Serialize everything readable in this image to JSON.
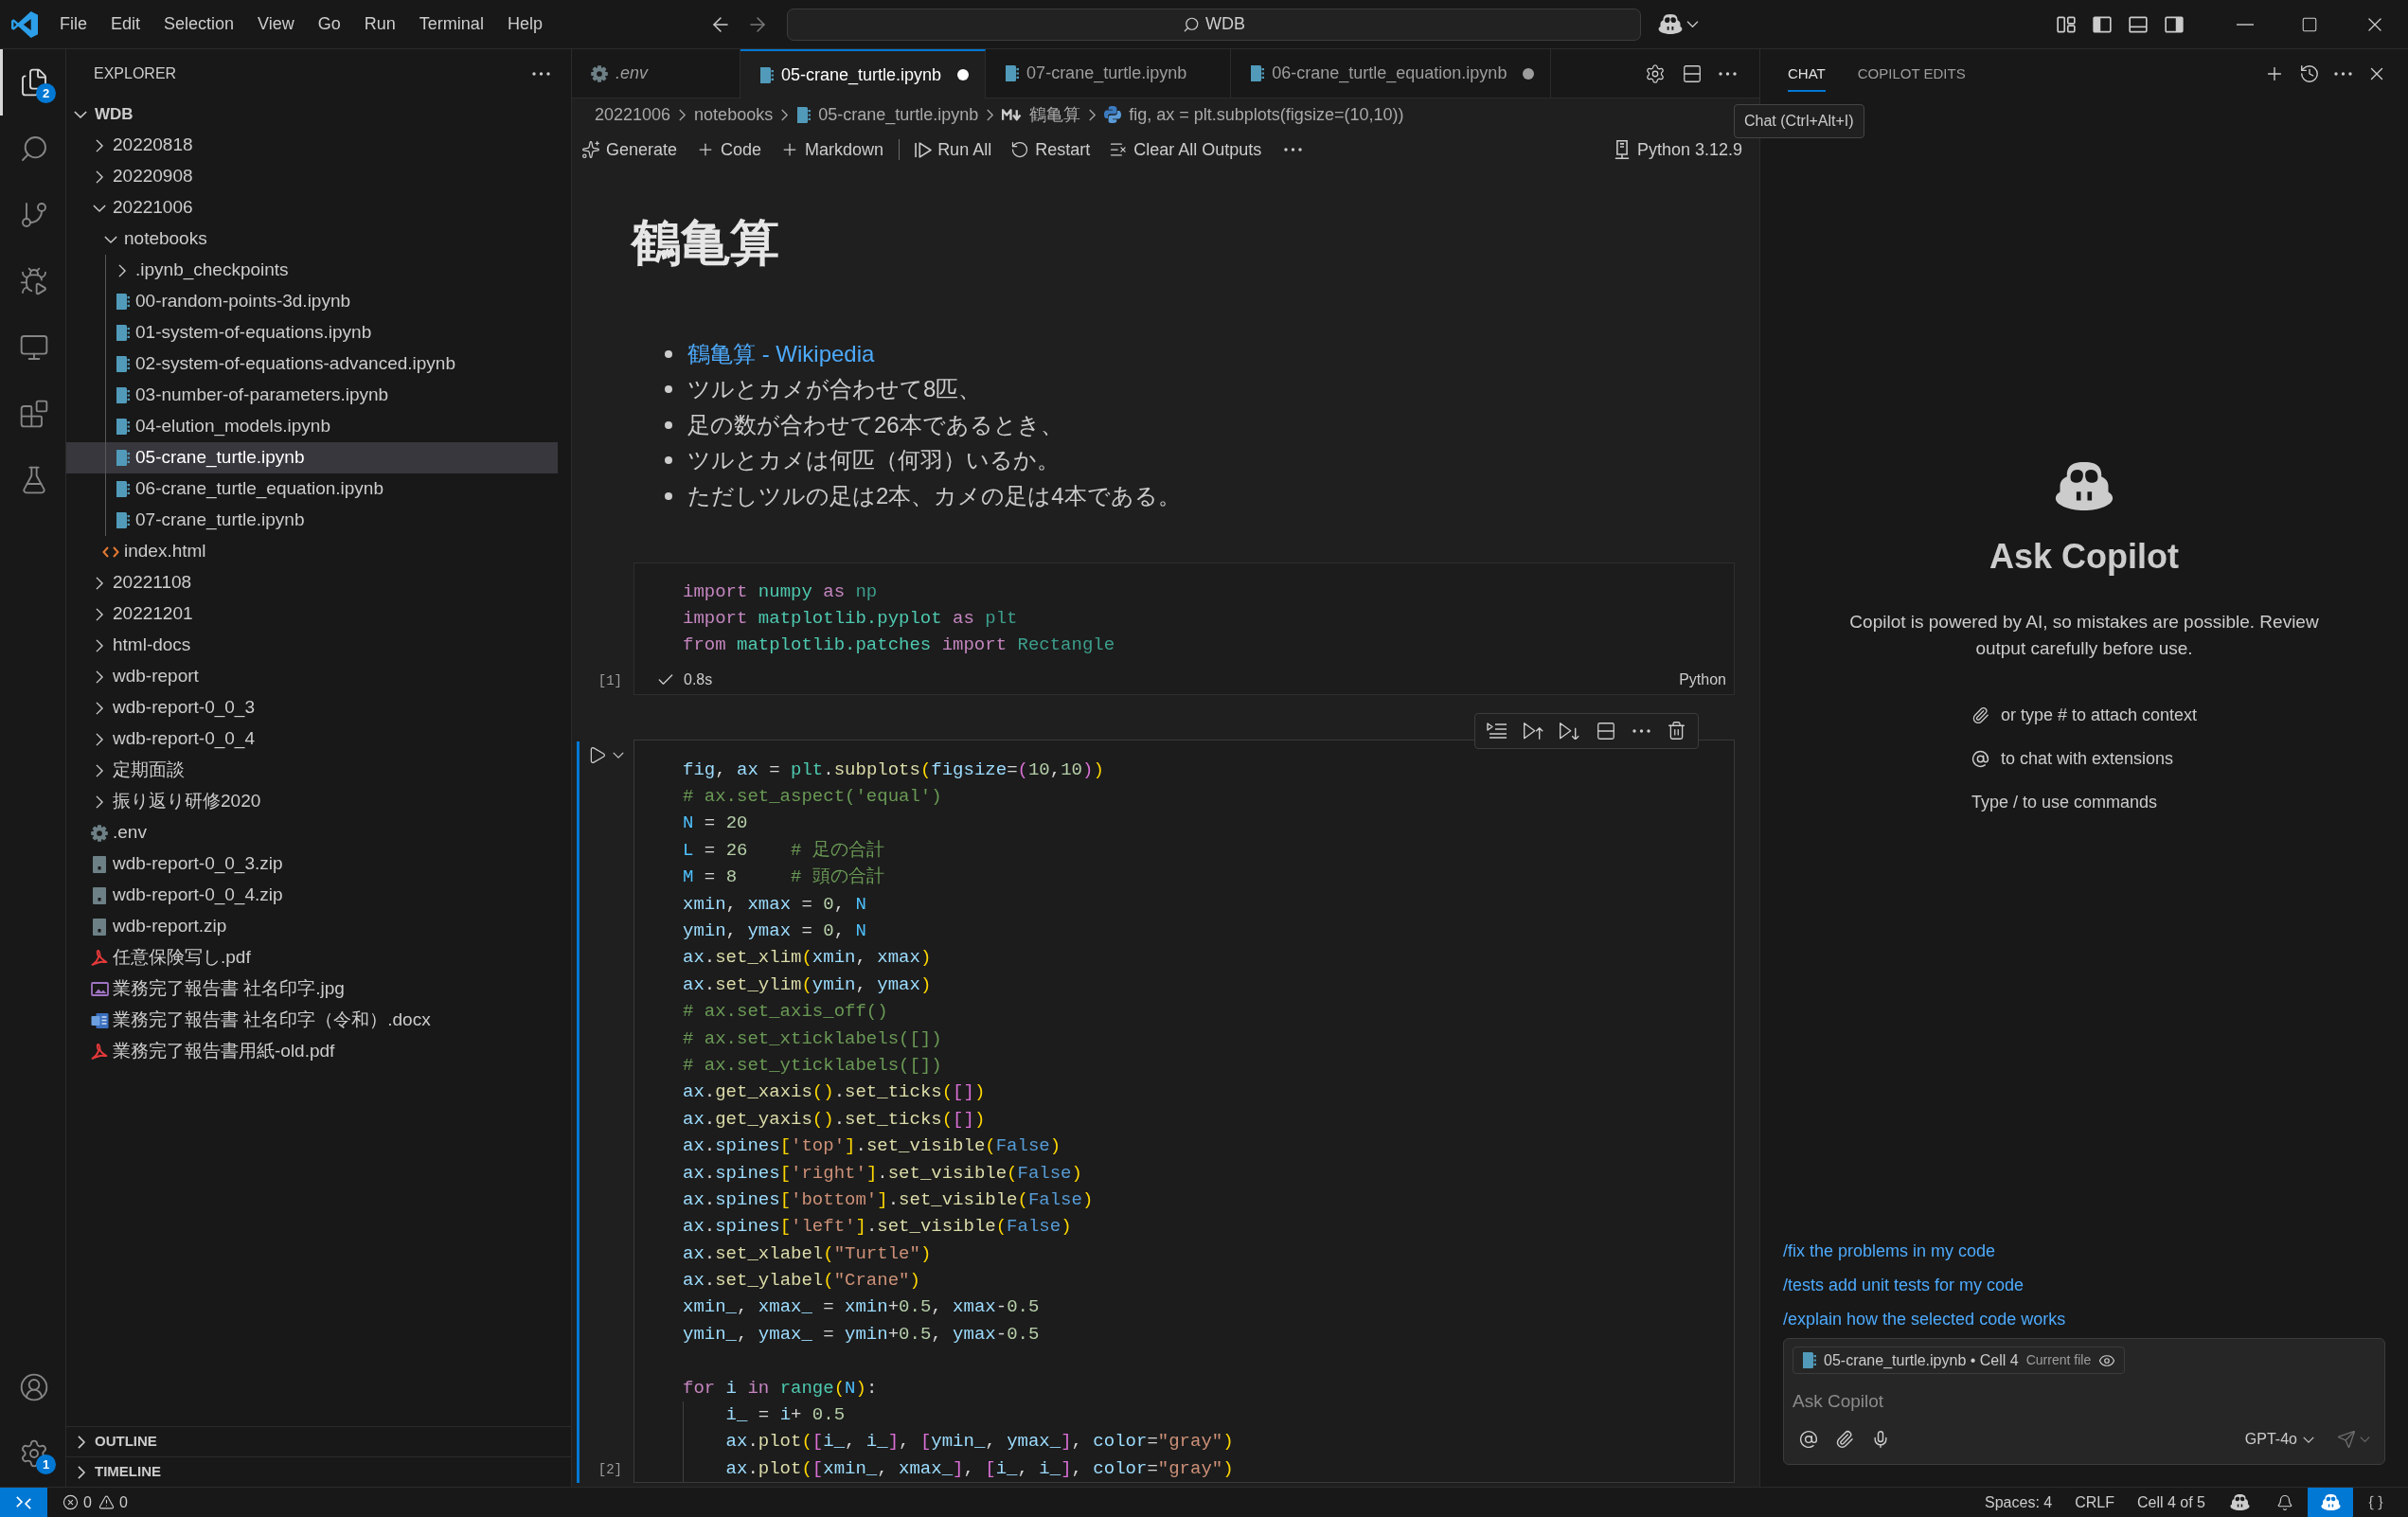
{
  "title_bar": {
    "menu": [
      "File",
      "Edit",
      "Selection",
      "View",
      "Go",
      "Run",
      "Terminal",
      "Help"
    ],
    "command_center": "WDB",
    "layout_toggles": [
      {
        "kind": "customize"
      },
      {
        "kind": "primary_sidebar",
        "on": true
      },
      {
        "kind": "panel",
        "on": false
      },
      {
        "kind": "secondary_sidebar",
        "on": true
      }
    ]
  },
  "activity_bar": {
    "items": [
      {
        "kind": "explorer",
        "selected": true,
        "badge": "2"
      },
      {
        "kind": "search",
        "selected": false
      },
      {
        "kind": "source_control",
        "selected": false
      },
      {
        "kind": "run_debug",
        "selected": false
      },
      {
        "kind": "remote",
        "selected": false
      },
      {
        "kind": "extensions",
        "selected": false
      },
      {
        "kind": "testing",
        "selected": false
      }
    ],
    "bottom": [
      {
        "kind": "account"
      },
      {
        "kind": "manage",
        "badge": "1"
      }
    ]
  },
  "sidebar": {
    "title": "EXPLORER",
    "root": {
      "label": "WDB",
      "expanded": true,
      "selected": false,
      "children": [
        {
          "kind": "folder",
          "label": "20220818",
          "expanded": false,
          "selected": false
        },
        {
          "kind": "folder",
          "label": "20220908",
          "expanded": false,
          "selected": false
        },
        {
          "kind": "folder",
          "label": "20221006",
          "expanded": true,
          "selected": false,
          "children": [
            {
              "kind": "folder",
              "label": "notebooks",
              "expanded": true,
              "selected": false,
              "children": [
                {
                  "kind": "folder",
                  "label": ".ipynb_checkpoints",
                  "expanded": false,
                  "selected": false
                },
                {
                  "kind": "notebook",
                  "label": "00-random-points-3d.ipynb",
                  "selected": false
                },
                {
                  "kind": "notebook",
                  "label": "01-system-of-equations.ipynb",
                  "selected": false
                },
                {
                  "kind": "notebook",
                  "label": "02-system-of-equations-advanced.ipynb",
                  "selected": false
                },
                {
                  "kind": "notebook",
                  "label": "03-number-of-parameters.ipynb",
                  "selected": false
                },
                {
                  "kind": "notebook",
                  "label": "04-elution_models.ipynb",
                  "selected": false
                },
                {
                  "kind": "notebook",
                  "label": "05-crane_turtle.ipynb",
                  "selected": true
                },
                {
                  "kind": "notebook",
                  "label": "06-crane_turtle_equation.ipynb",
                  "selected": false
                },
                {
                  "kind": "notebook",
                  "label": "07-crane_turtle.ipynb",
                  "selected": false
                }
              ]
            },
            {
              "kind": "html",
              "label": "index.html",
              "selected": false
            }
          ]
        },
        {
          "kind": "folder",
          "label": "20221108",
          "expanded": false,
          "selected": false
        },
        {
          "kind": "folder",
          "label": "20221201",
          "expanded": false,
          "selected": false
        },
        {
          "kind": "folder",
          "label": "html-docs",
          "expanded": false,
          "selected": false
        },
        {
          "kind": "folder",
          "label": "wdb-report",
          "expanded": false,
          "selected": false
        },
        {
          "kind": "folder",
          "label": "wdb-report-0_0_3",
          "expanded": false,
          "selected": false
        },
        {
          "kind": "folder",
          "label": "wdb-report-0_0_4",
          "expanded": false,
          "selected": false
        },
        {
          "kind": "folder",
          "label": "定期面談",
          "expanded": false,
          "selected": false
        },
        {
          "kind": "folder",
          "label": "振り返り研修2020",
          "expanded": false,
          "selected": false
        },
        {
          "kind": "env",
          "label": ".env",
          "selected": false
        },
        {
          "kind": "zip",
          "label": "wdb-report-0_0_3.zip",
          "selected": false
        },
        {
          "kind": "zip",
          "label": "wdb-report-0_0_4.zip",
          "selected": false
        },
        {
          "kind": "zip",
          "label": "wdb-report.zip",
          "selected": false
        },
        {
          "kind": "pdf",
          "label": "任意保険写し.pdf",
          "selected": false
        },
        {
          "kind": "image",
          "label": "業務完了報告書 社名印字.jpg",
          "selected": false
        },
        {
          "kind": "word",
          "label": "業務完了報告書 社名印字（令和）.docx",
          "selected": false
        },
        {
          "kind": "pdf",
          "label": "業務完了報告書用紙-old.pdf",
          "selected": false
        }
      ]
    },
    "sections": [
      {
        "label": "OUTLINE",
        "expanded": false
      },
      {
        "label": "TIMELINE",
        "expanded": false
      }
    ]
  },
  "editor": {
    "tabs": [
      {
        "kind": "env",
        "label": ".env",
        "selected": false,
        "modified": false,
        "preview": true
      },
      {
        "kind": "notebook",
        "label": "05-crane_turtle.ipynb",
        "selected": true,
        "modified": true,
        "preview": false
      },
      {
        "kind": "notebook",
        "label": "07-crane_turtle.ipynb",
        "selected": false,
        "modified": false,
        "preview": false
      },
      {
        "kind": "notebook",
        "label": "06-crane_turtle_equation.ipynb",
        "selected": false,
        "modified": true,
        "preview": false
      }
    ],
    "breadcrumbs": [
      {
        "kind": "folder",
        "label": "20221006"
      },
      {
        "kind": "folder",
        "label": "notebooks"
      },
      {
        "kind": "notebook",
        "label": "05-crane_turtle.ipynb"
      },
      {
        "kind": "markdown",
        "label": "鶴亀算"
      },
      {
        "kind": "python",
        "label": "fig, ax = plt.subplots(figsize=(10,10))"
      }
    ],
    "toolbar": {
      "insert_actions": [
        {
          "kind": "generate",
          "label": "Generate"
        },
        {
          "kind": "add",
          "label": "Code"
        },
        {
          "kind": "add",
          "label": "Markdown"
        }
      ],
      "run_actions": [
        {
          "kind": "run_all",
          "label": "Run All"
        },
        {
          "kind": "restart",
          "label": "Restart"
        },
        {
          "kind": "clear",
          "label": "Clear All Outputs"
        }
      ],
      "kernel": "Python 3.12.9"
    },
    "cells": [
      {
        "kind": "markdown",
        "heading": "鶴亀算",
        "bullets": [
          {
            "text": "鶴亀算 - Wikipedia",
            "link": true
          },
          {
            "text": "ツルとカメが合わせて8匹、",
            "link": false
          },
          {
            "text": "足の数が合わせて26本であるとき、",
            "link": false
          },
          {
            "text": "ツルとカメは何匹（何羽）いるか。",
            "link": false
          },
          {
            "text": "ただしツルの足は2本、カメの足は4本である。",
            "link": false
          }
        ]
      },
      {
        "kind": "code",
        "selected": false,
        "execution_count": "[1]",
        "run": {
          "succeeded": true,
          "duration": "0.8s"
        },
        "language": "Python",
        "blocks": [
          [
            {
              "tokens": [
                {
                  "kind": "keyword",
                  "text": "import"
                },
                {
                  "kind": "module",
                  "text": " numpy"
                },
                {
                  "kind": "keyword",
                  "text": " as"
                },
                {
                  "kind": "alias",
                  "text": " np"
                }
              ]
            },
            {
              "tokens": [
                {
                  "kind": "keyword",
                  "text": "import"
                },
                {
                  "kind": "module",
                  "text": " matplotlib.pyplot"
                },
                {
                  "kind": "keyword",
                  "text": " as"
                },
                {
                  "kind": "alias",
                  "text": " plt"
                }
              ]
            },
            {
              "tokens": [
                {
                  "kind": "keyword",
                  "text": "from"
                },
                {
                  "kind": "module",
                  "text": " matplotlib.patches"
                },
                {
                  "kind": "keyword",
                  "text": " import"
                },
                {
                  "kind": "alias",
                  "text": " Rectangle"
                }
              ]
            }
          ]
        ]
      },
      {
        "kind": "code",
        "selected": true,
        "execution_count": "[2]",
        "blocks": [
          [
            {
              "tokens": [
                {
                  "kind": "variable",
                  "text": "fig"
                },
                {
                  "kind": "plain",
                  "text": ", "
                },
                {
                  "kind": "variable",
                  "text": "ax"
                },
                {
                  "kind": "plain",
                  "text": " = "
                },
                {
                  "kind": "module",
                  "text": "plt"
                },
                {
                  "kind": "plain",
                  "text": "."
                },
                {
                  "kind": "function",
                  "text": "subplots"
                },
                {
                  "kind": "outer_bracket",
                  "text": "("
                },
                {
                  "kind": "variable",
                  "text": "figsize"
                },
                {
                  "kind": "plain",
                  "text": "="
                },
                {
                  "kind": "inner_bracket",
                  "text": "("
                },
                {
                  "kind": "number",
                  "text": "10"
                },
                {
                  "kind": "plain",
                  "text": ","
                },
                {
                  "kind": "number",
                  "text": "10"
                },
                {
                  "kind": "inner_bracket",
                  "text": ")"
                },
                {
                  "kind": "outer_bracket",
                  "text": ")"
                }
              ]
            },
            {
              "tokens": [
                {
                  "kind": "comment",
                  "text": "# ax.set_aspect('equal')"
                }
              ]
            },
            {
              "tokens": [
                {
                  "kind": "constant",
                  "text": "N"
                },
                {
                  "kind": "plain",
                  "text": " = "
                },
                {
                  "kind": "number",
                  "text": "20"
                }
              ]
            },
            {
              "tokens": [
                {
                  "kind": "constant",
                  "text": "L"
                },
                {
                  "kind": "plain",
                  "text": " = "
                },
                {
                  "kind": "number",
                  "text": "26"
                },
                {
                  "kind": "comment",
                  "text": "    # 足の合計"
                }
              ]
            },
            {
              "tokens": [
                {
                  "kind": "constant",
                  "text": "M"
                },
                {
                  "kind": "plain",
                  "text": " = "
                },
                {
                  "kind": "number",
                  "text": "8"
                },
                {
                  "kind": "comment",
                  "text": "     # 頭の合計"
                }
              ]
            },
            {
              "tokens": [
                {
                  "kind": "variable",
                  "text": "xmin"
                },
                {
                  "kind": "plain",
                  "text": ", "
                },
                {
                  "kind": "variable",
                  "text": "xmax"
                },
                {
                  "kind": "plain",
                  "text": " = "
                },
                {
                  "kind": "number",
                  "text": "0"
                },
                {
                  "kind": "plain",
                  "text": ", "
                },
                {
                  "kind": "constant",
                  "text": "N"
                }
              ]
            },
            {
              "tokens": [
                {
                  "kind": "variable",
                  "text": "ymin"
                },
                {
                  "kind": "plain",
                  "text": ", "
                },
                {
                  "kind": "variable",
                  "text": "ymax"
                },
                {
                  "kind": "plain",
                  "text": " = "
                },
                {
                  "kind": "number",
                  "text": "0"
                },
                {
                  "kind": "plain",
                  "text": ", "
                },
                {
                  "kind": "constant",
                  "text": "N"
                }
              ]
            },
            {
              "tokens": [
                {
                  "kind": "variable",
                  "text": "ax"
                },
                {
                  "kind": "plain",
                  "text": "."
                },
                {
                  "kind": "function",
                  "text": "set_xlim"
                },
                {
                  "kind": "outer_bracket",
                  "text": "("
                },
                {
                  "kind": "variable",
                  "text": "xmin"
                },
                {
                  "kind": "plain",
                  "text": ", "
                },
                {
                  "kind": "variable",
                  "text": "xmax"
                },
                {
                  "kind": "outer_bracket",
                  "text": ")"
                }
              ]
            },
            {
              "tokens": [
                {
                  "kind": "variable",
                  "text": "ax"
                },
                {
                  "kind": "plain",
                  "text": "."
                },
                {
                  "kind": "function",
                  "text": "set_ylim"
                },
                {
                  "kind": "outer_bracket",
                  "text": "("
                },
                {
                  "kind": "variable",
                  "text": "ymin"
                },
                {
                  "kind": "plain",
                  "text": ", "
                },
                {
                  "kind": "variable",
                  "text": "ymax"
                },
                {
                  "kind": "outer_bracket",
                  "text": ")"
                }
              ]
            },
            {
              "tokens": [
                {
                  "kind": "comment",
                  "text": "# ax.set_axis_off()"
                }
              ]
            },
            {
              "tokens": [
                {
                  "kind": "comment",
                  "text": "# ax.set_xticklabels([])"
                }
              ]
            },
            {
              "tokens": [
                {
                  "kind": "comment",
                  "text": "# ax.set_yticklabels([])"
                }
              ]
            },
            {
              "tokens": [
                {
                  "kind": "variable",
                  "text": "ax"
                },
                {
                  "kind": "plain",
                  "text": "."
                },
                {
                  "kind": "function",
                  "text": "get_xaxis"
                },
                {
                  "kind": "outer_bracket",
                  "text": "()"
                },
                {
                  "kind": "plain",
                  "text": "."
                },
                {
                  "kind": "function",
                  "text": "set_ticks"
                },
                {
                  "kind": "outer_bracket",
                  "text": "("
                },
                {
                  "kind": "inner_bracket",
                  "text": "[]"
                },
                {
                  "kind": "outer_bracket",
                  "text": ")"
                }
              ]
            },
            {
              "tokens": [
                {
                  "kind": "variable",
                  "text": "ax"
                },
                {
                  "kind": "plain",
                  "text": "."
                },
                {
                  "kind": "function",
                  "text": "get_yaxis"
                },
                {
                  "kind": "outer_bracket",
                  "text": "()"
                },
                {
                  "kind": "plain",
                  "text": "."
                },
                {
                  "kind": "function",
                  "text": "set_ticks"
                },
                {
                  "kind": "outer_bracket",
                  "text": "("
                },
                {
                  "kind": "inner_bracket",
                  "text": "[]"
                },
                {
                  "kind": "outer_bracket",
                  "text": ")"
                }
              ]
            },
            {
              "tokens": [
                {
                  "kind": "variable",
                  "text": "ax"
                },
                {
                  "kind": "plain",
                  "text": "."
                },
                {
                  "kind": "variable",
                  "text": "spines"
                },
                {
                  "kind": "outer_bracket",
                  "text": "["
                },
                {
                  "kind": "string",
                  "text": "'top'"
                },
                {
                  "kind": "outer_bracket",
                  "text": "]"
                },
                {
                  "kind": "plain",
                  "text": "."
                },
                {
                  "kind": "function",
                  "text": "set_visible"
                },
                {
                  "kind": "outer_bracket",
                  "text": "("
                },
                {
                  "kind": "boolean",
                  "text": "False"
                },
                {
                  "kind": "outer_bracket",
                  "text": ")"
                }
              ]
            },
            {
              "tokens": [
                {
                  "kind": "variable",
                  "text": "ax"
                },
                {
                  "kind": "plain",
                  "text": "."
                },
                {
                  "kind": "variable",
                  "text": "spines"
                },
                {
                  "kind": "outer_bracket",
                  "text": "["
                },
                {
                  "kind": "string",
                  "text": "'right'"
                },
                {
                  "kind": "outer_bracket",
                  "text": "]"
                },
                {
                  "kind": "plain",
                  "text": "."
                },
                {
                  "kind": "function",
                  "text": "set_visible"
                },
                {
                  "kind": "outer_bracket",
                  "text": "("
                },
                {
                  "kind": "boolean",
                  "text": "False"
                },
                {
                  "kind": "outer_bracket",
                  "text": ")"
                }
              ]
            },
            {
              "tokens": [
                {
                  "kind": "variable",
                  "text": "ax"
                },
                {
                  "kind": "plain",
                  "text": "."
                },
                {
                  "kind": "variable",
                  "text": "spines"
                },
                {
                  "kind": "outer_bracket",
                  "text": "["
                },
                {
                  "kind": "string",
                  "text": "'bottom'"
                },
                {
                  "kind": "outer_bracket",
                  "text": "]"
                },
                {
                  "kind": "plain",
                  "text": "."
                },
                {
                  "kind": "function",
                  "text": "set_visible"
                },
                {
                  "kind": "outer_bracket",
                  "text": "("
                },
                {
                  "kind": "boolean",
                  "text": "False"
                },
                {
                  "kind": "outer_bracket",
                  "text": ")"
                }
              ]
            },
            {
              "tokens": [
                {
                  "kind": "variable",
                  "text": "ax"
                },
                {
                  "kind": "plain",
                  "text": "."
                },
                {
                  "kind": "variable",
                  "text": "spines"
                },
                {
                  "kind": "outer_bracket",
                  "text": "["
                },
                {
                  "kind": "string",
                  "text": "'left'"
                },
                {
                  "kind": "outer_bracket",
                  "text": "]"
                },
                {
                  "kind": "plain",
                  "text": "."
                },
                {
                  "kind": "function",
                  "text": "set_visible"
                },
                {
                  "kind": "outer_bracket",
                  "text": "("
                },
                {
                  "kind": "boolean",
                  "text": "False"
                },
                {
                  "kind": "outer_bracket",
                  "text": ")"
                }
              ]
            },
            {
              "tokens": [
                {
                  "kind": "variable",
                  "text": "ax"
                },
                {
                  "kind": "plain",
                  "text": "."
                },
                {
                  "kind": "function",
                  "text": "set_xlabel"
                },
                {
                  "kind": "outer_bracket",
                  "text": "("
                },
                {
                  "kind": "string",
                  "text": "\"Turtle\""
                },
                {
                  "kind": "outer_bracket",
                  "text": ")"
                }
              ]
            },
            {
              "tokens": [
                {
                  "kind": "variable",
                  "text": "ax"
                },
                {
                  "kind": "plain",
                  "text": "."
                },
                {
                  "kind": "function",
                  "text": "set_ylabel"
                },
                {
                  "kind": "outer_bracket",
                  "text": "("
                },
                {
                  "kind": "string",
                  "text": "\"Crane\""
                },
                {
                  "kind": "outer_bracket",
                  "text": ")"
                }
              ]
            },
            {
              "tokens": [
                {
                  "kind": "variable",
                  "text": "xmin_"
                },
                {
                  "kind": "plain",
                  "text": ", "
                },
                {
                  "kind": "variable",
                  "text": "xmax_"
                },
                {
                  "kind": "plain",
                  "text": " = "
                },
                {
                  "kind": "variable",
                  "text": "xmin"
                },
                {
                  "kind": "plain",
                  "text": "+"
                },
                {
                  "kind": "number",
                  "text": "0.5"
                },
                {
                  "kind": "plain",
                  "text": ", "
                },
                {
                  "kind": "variable",
                  "text": "xmax"
                },
                {
                  "kind": "plain",
                  "text": "-"
                },
                {
                  "kind": "number",
                  "text": "0.5"
                }
              ]
            },
            {
              "tokens": [
                {
                  "kind": "variable",
                  "text": "ymin_"
                },
                {
                  "kind": "plain",
                  "text": ", "
                },
                {
                  "kind": "variable",
                  "text": "ymax_"
                },
                {
                  "kind": "plain",
                  "text": " = "
                },
                {
                  "kind": "variable",
                  "text": "ymin"
                },
                {
                  "kind": "plain",
                  "text": "+"
                },
                {
                  "kind": "number",
                  "text": "0.5"
                },
                {
                  "kind": "plain",
                  "text": ", "
                },
                {
                  "kind": "variable",
                  "text": "ymax"
                },
                {
                  "kind": "plain",
                  "text": "-"
                },
                {
                  "kind": "number",
                  "text": "0.5"
                }
              ]
            }
          ],
          [
            {
              "tokens": [
                {
                  "kind": "keyword",
                  "text": "for"
                },
                {
                  "kind": "variable",
                  "text": " i"
                },
                {
                  "kind": "keyword",
                  "text": " in"
                },
                {
                  "kind": "class",
                  "text": " range"
                },
                {
                  "kind": "outer_bracket",
                  "text": "("
                },
                {
                  "kind": "constant",
                  "text": "N"
                },
                {
                  "kind": "outer_bracket",
                  "text": ")"
                },
                {
                  "kind": "plain",
                  "text": ":"
                }
              ],
              "children": [
                {
                  "tokens": [
                    {
                      "kind": "variable",
                      "text": "i_"
                    },
                    {
                      "kind": "plain",
                      "text": " = "
                    },
                    {
                      "kind": "variable",
                      "text": "i"
                    },
                    {
                      "kind": "plain",
                      "text": "+ "
                    },
                    {
                      "kind": "number",
                      "text": "0.5"
                    }
                  ]
                },
                {
                  "tokens": [
                    {
                      "kind": "variable",
                      "text": "ax"
                    },
                    {
                      "kind": "plain",
                      "text": "."
                    },
                    {
                      "kind": "function",
                      "text": "plot"
                    },
                    {
                      "kind": "outer_bracket",
                      "text": "("
                    },
                    {
                      "kind": "inner_bracket",
                      "text": "["
                    },
                    {
                      "kind": "variable",
                      "text": "i_"
                    },
                    {
                      "kind": "plain",
                      "text": ", "
                    },
                    {
                      "kind": "variable",
                      "text": "i_"
                    },
                    {
                      "kind": "inner_bracket",
                      "text": "]"
                    },
                    {
                      "kind": "plain",
                      "text": ", "
                    },
                    {
                      "kind": "inner_bracket",
                      "text": "["
                    },
                    {
                      "kind": "variable",
                      "text": "ymin_"
                    },
                    {
                      "kind": "plain",
                      "text": ", "
                    },
                    {
                      "kind": "variable",
                      "text": "ymax_"
                    },
                    {
                      "kind": "inner_bracket",
                      "text": "]"
                    },
                    {
                      "kind": "plain",
                      "text": ", "
                    },
                    {
                      "kind": "variable",
                      "text": "color"
                    },
                    {
                      "kind": "plain",
                      "text": "="
                    },
                    {
                      "kind": "string",
                      "text": "\"gray\""
                    },
                    {
                      "kind": "outer_bracket",
                      "text": ")"
                    }
                  ]
                },
                {
                  "tokens": [
                    {
                      "kind": "variable",
                      "text": "ax"
                    },
                    {
                      "kind": "plain",
                      "text": "."
                    },
                    {
                      "kind": "function",
                      "text": "plot"
                    },
                    {
                      "kind": "outer_bracket",
                      "text": "("
                    },
                    {
                      "kind": "inner_bracket",
                      "text": "["
                    },
                    {
                      "kind": "variable",
                      "text": "xmin_"
                    },
                    {
                      "kind": "plain",
                      "text": ", "
                    },
                    {
                      "kind": "variable",
                      "text": "xmax_"
                    },
                    {
                      "kind": "inner_bracket",
                      "text": "]"
                    },
                    {
                      "kind": "plain",
                      "text": ", "
                    },
                    {
                      "kind": "inner_bracket",
                      "text": "["
                    },
                    {
                      "kind": "variable",
                      "text": "i_"
                    },
                    {
                      "kind": "plain",
                      "text": ", "
                    },
                    {
                      "kind": "variable",
                      "text": "i_"
                    },
                    {
                      "kind": "inner_bracket",
                      "text": "]"
                    },
                    {
                      "kind": "plain",
                      "text": ", "
                    },
                    {
                      "kind": "variable",
                      "text": "color"
                    },
                    {
                      "kind": "plain",
                      "text": "="
                    },
                    {
                      "kind": "string",
                      "text": "\"gray\""
                    },
                    {
                      "kind": "outer_bracket",
                      "text": ")"
                    }
                  ]
                }
              ]
            }
          ]
        ]
      }
    ]
  },
  "chat": {
    "tabs": [
      {
        "label": "CHAT",
        "selected": true
      },
      {
        "label": "COPILOT EDITS",
        "selected": false
      }
    ],
    "tooltip": "Chat (Ctrl+Alt+I)",
    "title": "Ask Copilot",
    "disclaimer": "Copilot is powered by AI, so mistakes are possible. Review output carefully before use.",
    "hints": [
      {
        "kind": "attach",
        "text": "or type # to attach context"
      },
      {
        "kind": "mention",
        "text": "to chat with extensions"
      },
      {
        "kind": "plain",
        "text": "Type / to use commands"
      }
    ],
    "suggestions": [
      "/fix the problems in my code",
      "/tests add unit tests for my code",
      "/explain how the selected code works"
    ],
    "input": {
      "attachment": {
        "label": "05-crane_turtle.ipynb • Cell 4",
        "note": "Current file"
      },
      "placeholder": "Ask Copilot",
      "model": "GPT-4o"
    }
  },
  "status_bar": {
    "problems": {
      "errors": "0",
      "warnings": "0"
    },
    "items": [
      "Spaces: 4",
      "CRLF",
      "Cell 4 of 5"
    ],
    "indicators": [
      {
        "kind": "copilot",
        "highlighted": false
      },
      {
        "kind": "bell",
        "highlighted": false
      },
      {
        "kind": "copilot",
        "highlighted": true
      },
      {
        "kind": "braces",
        "highlighted": false
      }
    ]
  }
}
